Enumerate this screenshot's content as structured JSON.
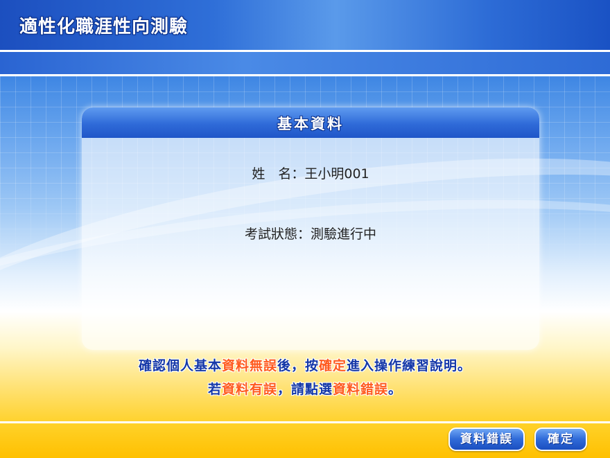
{
  "header": {
    "title": "適性化職涯性向測驗"
  },
  "panel": {
    "title": "基本資料",
    "name_label": "姓　名：",
    "name_value": "王小明001",
    "status_label": "考試狀態：",
    "status_value": "測驗進行中"
  },
  "message": {
    "line1": [
      {
        "text": "確認個人基本",
        "highlight": false
      },
      {
        "text": "資料無誤",
        "highlight": true
      },
      {
        "text": "後，按",
        "highlight": false
      },
      {
        "text": "確定",
        "highlight": true
      },
      {
        "text": "進入操作練習說明。",
        "highlight": false
      }
    ],
    "line2": [
      {
        "text": "若",
        "highlight": false
      },
      {
        "text": "資料有誤",
        "highlight": true
      },
      {
        "text": "，請點選",
        "highlight": false
      },
      {
        "text": "資料錯誤",
        "highlight": true
      },
      {
        "text": "。",
        "highlight": false
      }
    ]
  },
  "buttons": {
    "error_label": "資料錯誤",
    "confirm_label": "確定"
  },
  "colors": {
    "highlight": "#ff5a1e",
    "message_text": "#1538a8",
    "accent_blue": "#2f6ad8"
  }
}
